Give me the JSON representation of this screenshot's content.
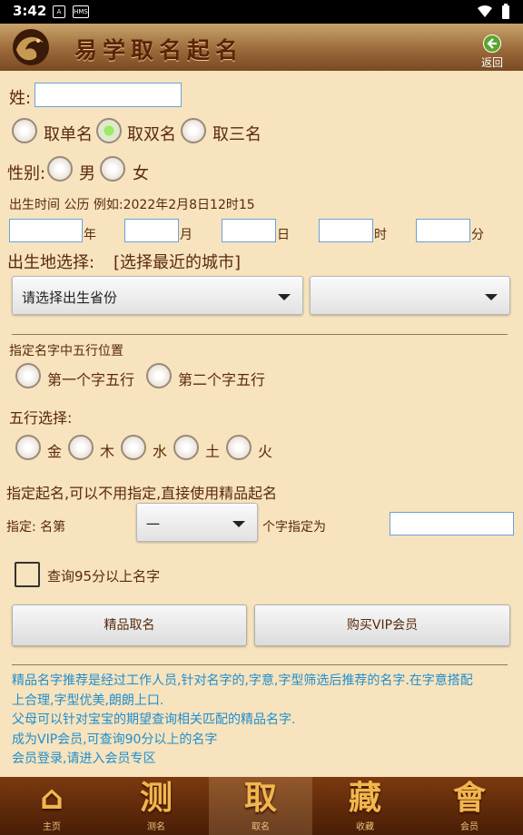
{
  "status": {
    "time": "3:42",
    "icon1": "A",
    "icon2": "HMS"
  },
  "header": {
    "title": "易学取名起名",
    "back_label": "返回"
  },
  "form": {
    "surname_label": "姓:",
    "surname_value": "",
    "name_type_options": [
      "取单名",
      "取双名",
      "取三名"
    ],
    "name_type_selected": "取双名",
    "gender_label": "性别:",
    "gender_options": [
      "男",
      "女"
    ],
    "birth_hint": "出生时间 公历 例如:2022年2月8日12时15",
    "date_units": {
      "year": "年",
      "month": "月",
      "day": "日",
      "hour": "时",
      "minute": "分"
    },
    "birthplace_label": "出生地选择:",
    "birthplace_link": "[选择最近的城市]",
    "province_selected": "请选择出生省份",
    "city_selected": "",
    "wuxing_position_label": "指定名字中五行位置",
    "wuxing_position_options": [
      "第一个字五行",
      "第二个字五行"
    ],
    "wuxing_label": "五行选择:",
    "wuxing_options": [
      "金",
      "木",
      "水",
      "土",
      "火"
    ],
    "specify_title": "指定起名,可以不用指定,直接使用精品起名",
    "specify_prefix": "指定: 名第",
    "specify_position": "一",
    "specify_suffix": "个字指定为",
    "query95_label": "查询95分以上名字",
    "btn_premium": "精品取名",
    "btn_vip": "购买VIP会员"
  },
  "info_lines": [
    "精品名字推荐是经过工作人员,针对名字的,字意,字型筛选后推荐的名字.在字意搭配",
    "上合理,字型优美,朗朗上口.",
    "父母可以针对宝宝的期望查询相关匹配的精品名字.",
    "成为VIP会员,可查询90分以上的名字",
    "会员登录,请进入会员专区"
  ],
  "bottom_nav": [
    {
      "glyph": "⌂",
      "label": "主页",
      "icon": "home-icon"
    },
    {
      "glyph": "测",
      "label": "测名",
      "icon": "test-name-icon"
    },
    {
      "glyph": "取",
      "label": "取名",
      "icon": "pick-name-icon"
    },
    {
      "glyph": "藏",
      "label": "收藏",
      "icon": "favorites-icon"
    },
    {
      "glyph": "會",
      "label": "会员",
      "icon": "member-icon"
    }
  ],
  "colors": {
    "background": "#f7e3bd",
    "text": "#5a2a0c",
    "info": "#1f8fd0",
    "radio_selected": "#9ee86a"
  }
}
